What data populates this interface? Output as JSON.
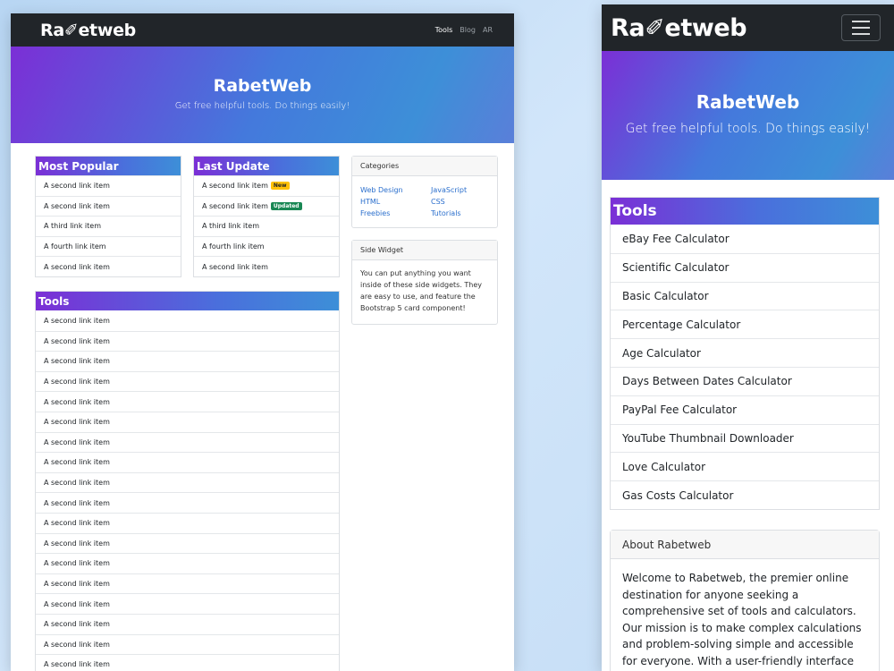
{
  "desktop": {
    "brand": "Ra✐etweb",
    "nav": [
      "Tools",
      "Blog",
      "AR"
    ],
    "hero": {
      "title": "RabetWeb",
      "subtitle": "Get free helpful tools. Do things easily!"
    },
    "most_popular": {
      "title": "Most Popular",
      "items": [
        "A second link item",
        "A second link item",
        "A third link item",
        "A fourth link item",
        "A second link item"
      ]
    },
    "last_update": {
      "title": "Last Update",
      "items": [
        {
          "label": "A second link item",
          "badge": "New"
        },
        {
          "label": "A second link item",
          "badge": "Updated"
        },
        {
          "label": "A third link item"
        },
        {
          "label": "A fourth link item"
        },
        {
          "label": "A second link item"
        }
      ]
    },
    "tools": {
      "title": "Tools",
      "items": [
        "A second link item",
        "A second link item",
        "A second link item",
        "A second link item",
        "A second link item",
        "A second link item",
        "A second link item",
        "A second link item",
        "A second link item",
        "A second link item",
        "A second link item",
        "A second link item",
        "A second link item",
        "A second link item",
        "A second link item",
        "A second link item",
        "A second link item",
        "A second link item"
      ]
    },
    "categories": {
      "title": "Categories",
      "links": [
        "Web Design",
        "JavaScript",
        "HTML",
        "CSS",
        "Freebies",
        "Tutorials"
      ]
    },
    "side_widget": {
      "title": "Side Widget",
      "body": "You can put anything you want inside of these side widgets. They are easy to use, and feature the Bootstrap 5 card component!"
    }
  },
  "mobile": {
    "brand": "Ra✐etweb",
    "hero": {
      "title": "RabetWeb",
      "subtitle": "Get free helpful tools. Do things easily!"
    },
    "tools": {
      "title": "Tools",
      "items": [
        "eBay Fee Calculator",
        "Scientific Calculator",
        "Basic Calculator",
        "Percentage Calculator",
        "Age Calculator",
        "Days Between Dates Calculator",
        "PayPal Fee Calculator",
        "YouTube Thumbnail Downloader",
        "Love Calculator",
        "Gas Costs Calculator"
      ]
    },
    "about": {
      "title": "About Rabetweb",
      "body": "Welcome to Rabetweb, the premier online destination for anyone seeking a comprehensive set of tools and calculators. Our mission is to make complex calculations and problem-solving simple and accessible for everyone. With a user-friendly interface and a wide range of"
    }
  },
  "colors": {
    "navbar": "#212529",
    "gradient_start": "#7b2fd6",
    "gradient_end": "#3d8fd8",
    "link": "#2b6fcd",
    "badge_new": "#ffc107",
    "badge_updated": "#198754"
  }
}
